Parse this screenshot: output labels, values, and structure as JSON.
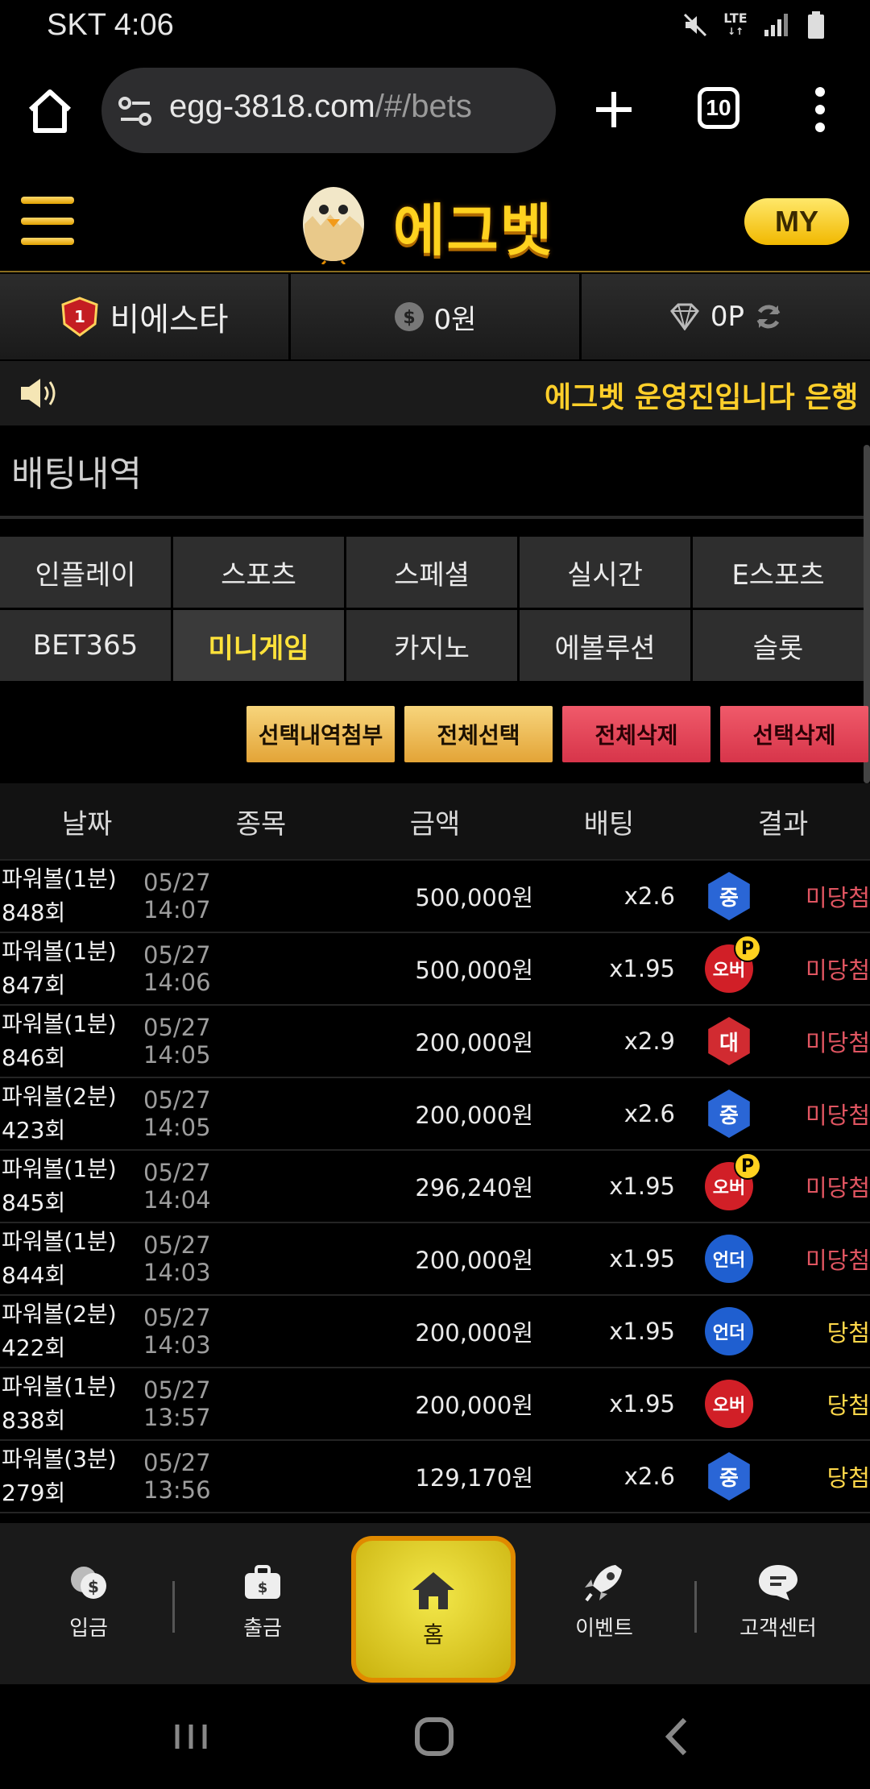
{
  "status": {
    "carrier_time": "SKT 4:06",
    "network": "LTE"
  },
  "browser": {
    "url_host": "egg-3818.com",
    "url_path": "/#/bets",
    "tab_count": "10"
  },
  "header": {
    "logo_text": "에그벳",
    "my_label": "MY"
  },
  "user": {
    "name": "비에스타",
    "level": "1",
    "balance": "0원",
    "points": "0P"
  },
  "notice": {
    "text": "에그벳 운영진입니다 은행"
  },
  "page": {
    "title": "배팅내역"
  },
  "categories": [
    {
      "label": "인플레이",
      "active": false
    },
    {
      "label": "스포츠",
      "active": false
    },
    {
      "label": "스페셜",
      "active": false
    },
    {
      "label": "실시간",
      "active": false
    },
    {
      "label": "E스포츠",
      "active": false
    },
    {
      "label": "BET365",
      "active": false
    },
    {
      "label": "미니게임",
      "active": true
    },
    {
      "label": "카지노",
      "active": false
    },
    {
      "label": "에볼루션",
      "active": false
    },
    {
      "label": "슬롯",
      "active": false
    }
  ],
  "actions": {
    "attach": "선택내역첨부",
    "select_all": "전체선택",
    "delete_all": "전체삭제",
    "delete_selected": "선택삭제"
  },
  "table": {
    "headers": {
      "date": "날짜",
      "game": "종목",
      "amount": "금액",
      "bet": "배팅",
      "result": "결과"
    },
    "rows": [
      {
        "game1": "파워볼(1분)",
        "game2": "848회",
        "date": "05/27 14:07",
        "amount": "500,000원",
        "odds": "x2.6",
        "pick": "중",
        "pick_shape": "hex",
        "pick_color": "#2a66d6",
        "power": false,
        "result": "미당첨",
        "win": false
      },
      {
        "game1": "파워볼(1분)",
        "game2": "847회",
        "date": "05/27 14:06",
        "amount": "500,000원",
        "odds": "x1.95",
        "pick": "오버",
        "pick_shape": "circle",
        "pick_color": "#d11f27",
        "power": true,
        "result": "미당첨",
        "win": false
      },
      {
        "game1": "파워볼(1분)",
        "game2": "846회",
        "date": "05/27 14:05",
        "amount": "200,000원",
        "odds": "x2.9",
        "pick": "대",
        "pick_shape": "hex",
        "pick_color": "#d12b31",
        "power": false,
        "result": "미당첨",
        "win": false
      },
      {
        "game1": "파워볼(2분)",
        "game2": "423회",
        "date": "05/27 14:05",
        "amount": "200,000원",
        "odds": "x2.6",
        "pick": "중",
        "pick_shape": "hex",
        "pick_color": "#2a66d6",
        "power": false,
        "result": "미당첨",
        "win": false
      },
      {
        "game1": "파워볼(1분)",
        "game2": "845회",
        "date": "05/27 14:04",
        "amount": "296,240원",
        "odds": "x1.95",
        "pick": "오버",
        "pick_shape": "circle",
        "pick_color": "#d11f27",
        "power": true,
        "result": "미당첨",
        "win": false
      },
      {
        "game1": "파워볼(1분)",
        "game2": "844회",
        "date": "05/27 14:03",
        "amount": "200,000원",
        "odds": "x1.95",
        "pick": "언더",
        "pick_shape": "circle",
        "pick_color": "#1f5fd0",
        "power": false,
        "result": "미당첨",
        "win": false
      },
      {
        "game1": "파워볼(2분)",
        "game2": "422회",
        "date": "05/27 14:03",
        "amount": "200,000원",
        "odds": "x1.95",
        "pick": "언더",
        "pick_shape": "circle",
        "pick_color": "#1f5fd0",
        "power": false,
        "result": "당첨",
        "win": true
      },
      {
        "game1": "파워볼(1분)",
        "game2": "838회",
        "date": "05/27 13:57",
        "amount": "200,000원",
        "odds": "x1.95",
        "pick": "오버",
        "pick_shape": "circle",
        "pick_color": "#d11f27",
        "power": false,
        "result": "당첨",
        "win": true
      },
      {
        "game1": "파워볼(3분)",
        "game2": "279회",
        "date": "05/27 13:56",
        "amount": "129,170원",
        "odds": "x2.6",
        "pick": "중",
        "pick_shape": "hex",
        "pick_color": "#2a66d6",
        "power": false,
        "result": "당첨",
        "win": true
      }
    ]
  },
  "bottom_nav": {
    "deposit": "입금",
    "withdraw": "출금",
    "home": "홈",
    "event": "이벤트",
    "support": "고객센터"
  },
  "colors": {
    "gold": "#ffd21f",
    "lose": "#e05561",
    "win": "#ffd84a"
  }
}
